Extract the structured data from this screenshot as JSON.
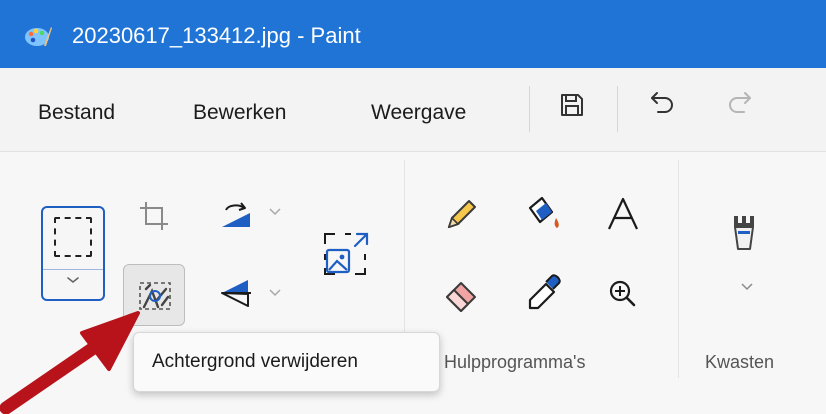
{
  "window": {
    "title": "20230617_133412.jpg - Paint"
  },
  "menu": {
    "items": [
      {
        "label": "Bestand"
      },
      {
        "label": "Bewerken"
      },
      {
        "label": "Weergave"
      }
    ]
  },
  "ribbon": {
    "groups": {
      "tools": {
        "label": "Hulpprogramma's"
      },
      "brushes": {
        "label": "Kwasten"
      }
    }
  },
  "tooltip": {
    "text": "Achtergrond verwijderen"
  },
  "colors": {
    "titlebar": "#1f74d6",
    "accent": "#1f5ec2",
    "arrow": "#b8131a"
  },
  "icons": [
    "paint-app-icon",
    "save-icon",
    "undo-icon",
    "redo-icon",
    "selection-icon",
    "crop-icon",
    "rotate-icon",
    "flip-icon",
    "resize-image-icon",
    "remove-background-icon",
    "pencil-icon",
    "fill-icon",
    "text-icon",
    "eraser-icon",
    "color-picker-icon",
    "magnifier-icon",
    "brush-icon",
    "annotation-arrow"
  ]
}
